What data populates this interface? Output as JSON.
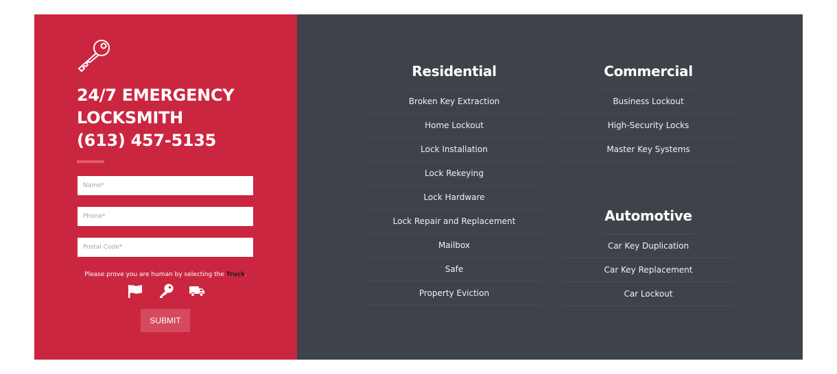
{
  "brand": {
    "logo_icon": "key-icon",
    "headline_lines": [
      "24/7 EMERGENCY",
      "LOCKSMITH",
      "(613) 457-5135"
    ],
    "accent_color": "#cb2640",
    "panel_color": "#3e4249"
  },
  "form": {
    "name_placeholder": "Name*",
    "phone_placeholder": "Phone*",
    "postal_placeholder": "Postal Code*",
    "captcha_prompt": "Please prove you are human by selecting the ",
    "captcha_target": "Truck",
    "captcha_suffix": ".",
    "captcha_icons": [
      "flag-icon",
      "key-icon",
      "truck-icon"
    ],
    "submit_label": "SUBMIT"
  },
  "services": {
    "residential": {
      "title": "Residential",
      "items": [
        "Broken Key Extraction",
        "Home Lockout",
        "Lock Installation",
        "Lock Rekeying",
        "Lock Hardware",
        "Lock Repair and Replacement",
        "Mailbox",
        "Safe",
        "Property Eviction"
      ]
    },
    "commercial": {
      "title": "Commercial",
      "items": [
        "Business Lockout",
        "High-Security Locks",
        "Master Key Systems"
      ]
    },
    "automotive": {
      "title": "Automotive",
      "items": [
        "Car Key Duplication",
        "Car Key Replacement",
        "Car Lockout"
      ]
    }
  }
}
